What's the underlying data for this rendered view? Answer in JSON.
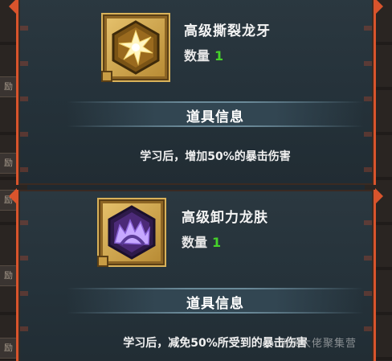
{
  "side_tab_label": "励",
  "items": [
    {
      "name": "高级撕裂龙牙",
      "quantity_label": "数量",
      "quantity_value": "1",
      "section_title": "道具信息",
      "description": "学习后，增加50%的暴击伤害",
      "icon": "star-burst-icon",
      "icon_colors": {
        "frame": "#d9b25a",
        "hex": "#7a5315",
        "glyph": "#fff6c2"
      }
    },
    {
      "name": "高级卸力龙肤",
      "quantity_label": "数量",
      "quantity_value": "1",
      "section_title": "道具信息",
      "description": "学习后，减免50%所受到的暴击伤害",
      "icon": "crown-shield-icon",
      "icon_colors": {
        "frame": "#d9b25a",
        "hex": "#4c2a78",
        "glyph": "#c6a8ff"
      }
    }
  ],
  "watermark": "佣兵大佬聚集营",
  "colors": {
    "border_accent": "#d9542c",
    "quantity": "#46d22a",
    "panel": "#2b3840"
  }
}
